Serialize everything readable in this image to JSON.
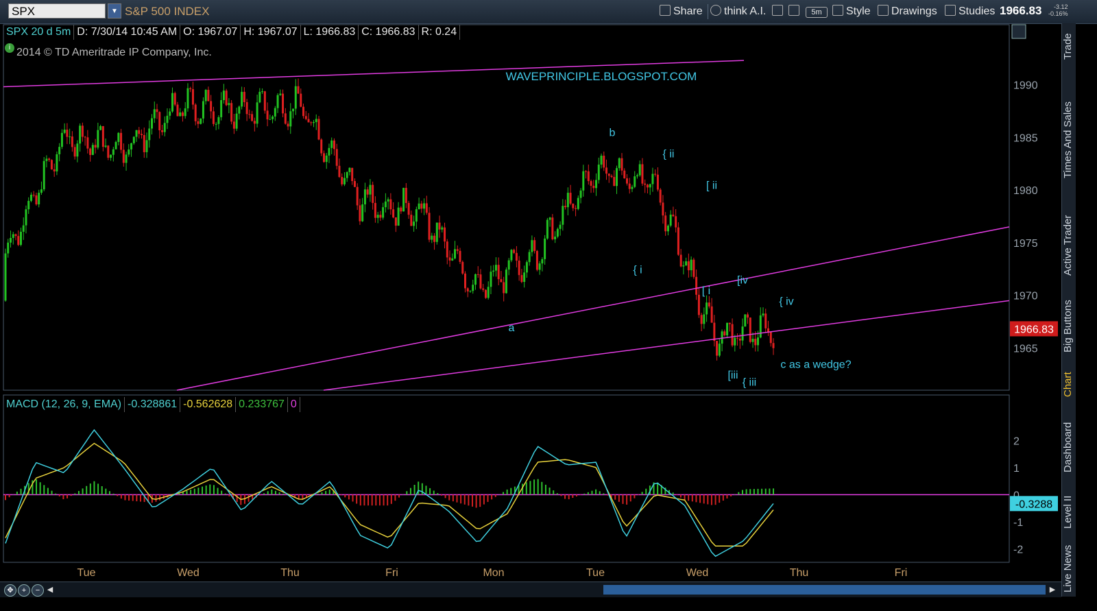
{
  "toolbar": {
    "symbol": "SPX",
    "index_name": "S&P 500 INDEX",
    "share": "Share",
    "think_ai": "think A.I.",
    "interval": "5m",
    "style": "Style",
    "drawings": "Drawings",
    "studies": "Studies",
    "last_price": "1966.83",
    "change": "-3.12",
    "change_pct": "-0.16%"
  },
  "info_bar": {
    "symbol_period": "SPX 20 d 5m",
    "date": "D: 7/30/14 10:45 AM",
    "open": "O: 1967.07",
    "high": "H: 1967.07",
    "low": "L: 1966.83",
    "close": "C: 1966.83",
    "range": "R: 0.24"
  },
  "copyright": "2014 © TD Ameritrade IP Company, Inc.",
  "watermark": "WAVEPRINCIPLE.BLOGSPOT.COM",
  "macd_bar": {
    "label": "MACD (12, 26, 9, EMA)",
    "value": "-0.328861",
    "avg": "-0.562628",
    "diff": "0.233767",
    "zero": "0"
  },
  "right_tabs": [
    "Trade",
    "Times And Sales",
    "Active Trader",
    "Big Buttons",
    "Chart",
    "Dashboard",
    "Level II",
    "Live News"
  ],
  "colors": {
    "up": "#22c322",
    "down": "#e02020",
    "trendline": "#e23ce2",
    "label": "#42c8e6",
    "macd_line": "#3fd0e0",
    "signal_line": "#e8d23c",
    "hist_up": "#2ec02e",
    "hist_down": "#d02020"
  },
  "chart_data": [
    {
      "type": "candlestick",
      "title": "SPX 20 d 5m",
      "ylim": [
        1961,
        1994
      ],
      "y_ticks": [
        "1990",
        "1985",
        "1980",
        "1975",
        "1970",
        "1965"
      ],
      "x_ticks": [
        "Tue",
        "Wed",
        "Thu",
        "Fri",
        "Mon",
        "Tue",
        "Wed",
        "Thu",
        "Fri"
      ],
      "current_price_label": "1966.83",
      "price_path": [
        {
          "session": "Tue",
          "open": 1969.5,
          "high": 1976,
          "low": 1968.5,
          "close": 1974
        },
        {
          "session": "Tue-pm",
          "open": 1974,
          "high": 1986.5,
          "low": 1972.5,
          "close": 1985
        },
        {
          "session": "Wed",
          "open": 1985,
          "high": 1986,
          "low": 1981.5,
          "close": 1984
        },
        {
          "session": "Wed-pm",
          "open": 1984,
          "high": 1989.5,
          "low": 1983,
          "close": 1988
        },
        {
          "session": "Thu",
          "open": 1988,
          "high": 1991.5,
          "low": 1985.5,
          "close": 1987.5
        },
        {
          "session": "Thu-pm",
          "open": 1987.5,
          "high": 1991.3,
          "low": 1986,
          "close": 1988
        },
        {
          "session": "Fri",
          "open": 1984.5,
          "high": 1984.8,
          "low": 1975,
          "close": 1979
        },
        {
          "session": "Fri-pm",
          "open": 1979,
          "high": 1980,
          "low": 1975.5,
          "close": 1978
        },
        {
          "session": "Mon",
          "open": 1978,
          "high": 1978.5,
          "low": 1967.5,
          "close": 1970.5
        },
        {
          "session": "Mon-pm",
          "open": 1970.5,
          "high": 1976.5,
          "low": 1970,
          "close": 1974
        },
        {
          "session": "Tue",
          "open": 1974,
          "high": 1984.5,
          "low": 1974,
          "close": 1982
        },
        {
          "session": "Tue-pm",
          "open": 1982,
          "high": 1981.5,
          "low": 1974,
          "close": 1980.5
        },
        {
          "session": "Wed",
          "open": 1979.5,
          "high": 1979,
          "low": 1963,
          "close": 1966
        },
        {
          "session": "Wed-now",
          "open": 1966,
          "high": 1968,
          "low": 1964.5,
          "close": 1966.83
        }
      ],
      "trendlines": [
        {
          "name": "upper channel",
          "from": [
            "Tue",
            1989.8
          ],
          "to": [
            "Wed",
            1992.3
          ]
        },
        {
          "name": "a-line",
          "from": [
            "Tue",
            1961
          ],
          "to": [
            "Thu",
            1976.5
          ]
        },
        {
          "name": "lower wedge line",
          "from": [
            "Fri",
            1961
          ],
          "to": [
            "Fri",
            1969.5
          ]
        }
      ],
      "annotations": [
        {
          "text": "a",
          "x": "Mon",
          "y": 1967
        },
        {
          "text": "b",
          "x": "Tue",
          "y": 1985.5
        },
        {
          "text": "{ i",
          "x": "Tue",
          "y": 1972.5
        },
        {
          "text": "{ ii",
          "x": "Tue",
          "y": 1983.5
        },
        {
          "text": "[ ii",
          "x": "Wed",
          "y": 1980.5
        },
        {
          "text": "[ i",
          "x": "Wed",
          "y": 1970.5
        },
        {
          "text": "[iv",
          "x": "Wed",
          "y": 1971.5
        },
        {
          "text": "{ iv",
          "x": "Wed",
          "y": 1969.5
        },
        {
          "text": "[iii",
          "x": "Wed",
          "y": 1962.5
        },
        {
          "text": "{ iii",
          "x": "Wed",
          "y": 1961.8
        },
        {
          "text": "c as a wedge?",
          "x": "Wed",
          "y": 1963.5
        }
      ]
    },
    {
      "type": "line",
      "title": "MACD (12, 26, 9, EMA)",
      "ylim": [
        -2.5,
        3
      ],
      "y_ticks": [
        "2",
        "1",
        "0",
        "-1",
        "-2"
      ],
      "current_value_label": "-0.3288",
      "series": [
        {
          "name": "MACD",
          "values": [
            -1.8,
            1.2,
            0.8,
            2.4,
            1.0,
            -0.5,
            0.2,
            1.0,
            -0.6,
            0.5,
            -0.4,
            0.5,
            -1.5,
            -2.0,
            0.2,
            -0.6,
            -1.8,
            -0.5,
            1.8,
            1.1,
            1.2,
            -1.6,
            0.5,
            -0.4,
            -2.3,
            -1.7,
            -0.33
          ]
        },
        {
          "name": "Avg",
          "values": [
            -1.6,
            0.6,
            1.0,
            1.9,
            1.2,
            -0.2,
            0.1,
            0.6,
            -0.2,
            0.3,
            -0.2,
            0.3,
            -1.1,
            -1.6,
            -0.3,
            -0.4,
            -1.3,
            -0.7,
            1.2,
            1.3,
            1.0,
            -1.2,
            0.0,
            -0.2,
            -1.9,
            -1.9,
            -0.56
          ]
        },
        {
          "name": "Diff",
          "values": [
            -0.2,
            0.6,
            -0.2,
            0.5,
            -0.2,
            -0.3,
            0.1,
            0.4,
            -0.4,
            0.2,
            -0.2,
            0.2,
            -0.4,
            -0.4,
            0.5,
            -0.2,
            -0.5,
            0.2,
            0.6,
            -0.2,
            0.2,
            -0.4,
            0.5,
            -0.2,
            -0.4,
            0.2,
            0.23
          ]
        }
      ]
    }
  ]
}
